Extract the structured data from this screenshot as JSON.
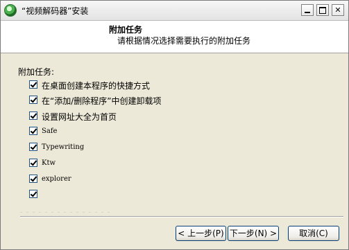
{
  "window": {
    "title": "“视频解码器”安装",
    "minimize_label": "_",
    "maximize_label": "",
    "close_label": "✕"
  },
  "header": {
    "title": "附加任务",
    "subtitle": "请根据情况选择需要执行的附加任务"
  },
  "section_label": "附加任务:",
  "tasks": [
    {
      "label": "在桌面创建本程序的快捷方式",
      "checked": true
    },
    {
      "label": "在“添加/删除程序”中创建卸载项",
      "checked": true
    },
    {
      "label": "设置网址大全为首页",
      "checked": true
    },
    {
      "label": "Safe",
      "checked": true
    },
    {
      "label": "Typewriting",
      "checked": true
    },
    {
      "label": "Ktw",
      "checked": true
    },
    {
      "label": "explorer",
      "checked": true
    },
    {
      "label": "",
      "checked": true
    }
  ],
  "buttons": {
    "back": "< 上一步(P)",
    "next": "下一步(N) >",
    "cancel": "取消(C)"
  }
}
